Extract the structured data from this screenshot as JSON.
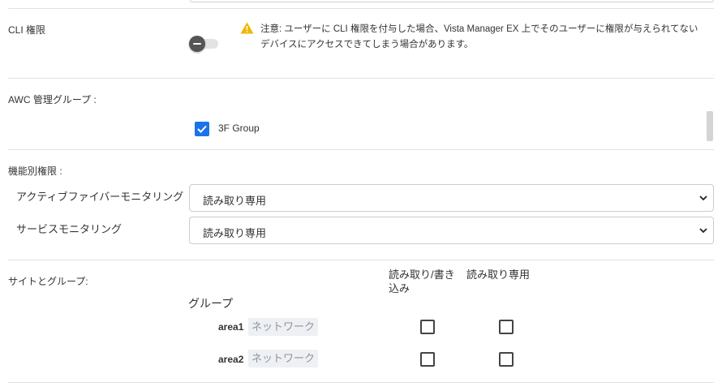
{
  "cli": {
    "label": "CLI 権限",
    "toggle_on": false,
    "warning": "注意: ユーザーに CLI 権限を付与した場合、Vista Manager EX 上でそのユーザーに権限が与えられてないデバイスにアクセスできてしまう場合があります。",
    "warning_color": "#f2b600"
  },
  "awc": {
    "label": "AWC 管理グループ :",
    "groups": [
      {
        "label": "3F Group",
        "checked": true
      }
    ]
  },
  "features": {
    "label": "機能別権限 :",
    "items": [
      {
        "label": "アクティブファイバーモニタリング",
        "value": "読み取り専用"
      },
      {
        "label": "サービスモニタリング",
        "value": "読み取り専用"
      }
    ]
  },
  "sites": {
    "label": "サイトとグループ:",
    "col_rw_line1": "読み取り/書き",
    "col_rw_line2": "込み",
    "col_ro": "読み取り専用",
    "group_header": "グループ",
    "rows": [
      {
        "name": "area1",
        "type": "ネットワーク",
        "rw": false,
        "ro": false
      },
      {
        "name": "area2",
        "type": "ネットワーク",
        "rw": false,
        "ro": false
      }
    ]
  },
  "colors": {
    "accent": "#1a73e8",
    "divider": "#e2e2e2"
  }
}
